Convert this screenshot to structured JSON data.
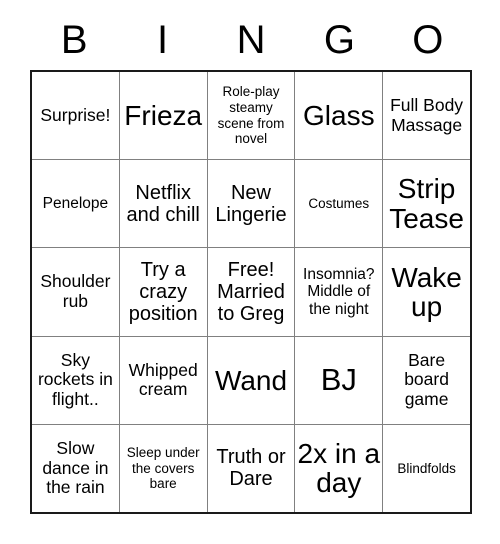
{
  "card": {
    "header_letters": [
      "B",
      "I",
      "N",
      "G",
      "O"
    ],
    "colors": {
      "background": "#ffffff",
      "text": "#000000",
      "outer_border": "#1a1a1a",
      "grid_line": "#808080"
    },
    "rows": [
      [
        {
          "text": "Surprise!",
          "size": "fs-17"
        },
        {
          "text": "Frieza",
          "size": "fs-28"
        },
        {
          "text": "Role-play steamy scene from novel",
          "size": "fs-13"
        },
        {
          "text": "Glass",
          "size": "fs-28"
        },
        {
          "text": "Full Body Massage",
          "size": "fs-17"
        }
      ],
      [
        {
          "text": "Penelope",
          "size": "fs-15"
        },
        {
          "text": "Netflix and chill",
          "size": "fs-20"
        },
        {
          "text": "New Lingerie",
          "size": "fs-20"
        },
        {
          "text": "Costumes",
          "size": "fs-13"
        },
        {
          "text": "Strip Tease",
          "size": "fs-28"
        }
      ],
      [
        {
          "text": "Shoulder rub",
          "size": "fs-17"
        },
        {
          "text": "Try a crazy position",
          "size": "fs-20"
        },
        {
          "text": "Free! Married to Greg",
          "size": "fs-20"
        },
        {
          "text": "Insomnia? Middle of the night",
          "size": "fs-15"
        },
        {
          "text": "Wake up",
          "size": "fs-28"
        }
      ],
      [
        {
          "text": "Sky rockets in flight..",
          "size": "fs-17"
        },
        {
          "text": "Whipped cream",
          "size": "fs-17"
        },
        {
          "text": "Wand",
          "size": "fs-28"
        },
        {
          "text": "BJ",
          "size": "fs-31"
        },
        {
          "text": "Bare board game",
          "size": "fs-17"
        }
      ],
      [
        {
          "text": "Slow dance in the rain",
          "size": "fs-17"
        },
        {
          "text": "Sleep under the covers bare",
          "size": "fs-13"
        },
        {
          "text": "Truth or Dare",
          "size": "fs-20"
        },
        {
          "text": "2x in a day",
          "size": "fs-28"
        },
        {
          "text": "Blindfolds",
          "size": "fs-13"
        }
      ]
    ]
  }
}
